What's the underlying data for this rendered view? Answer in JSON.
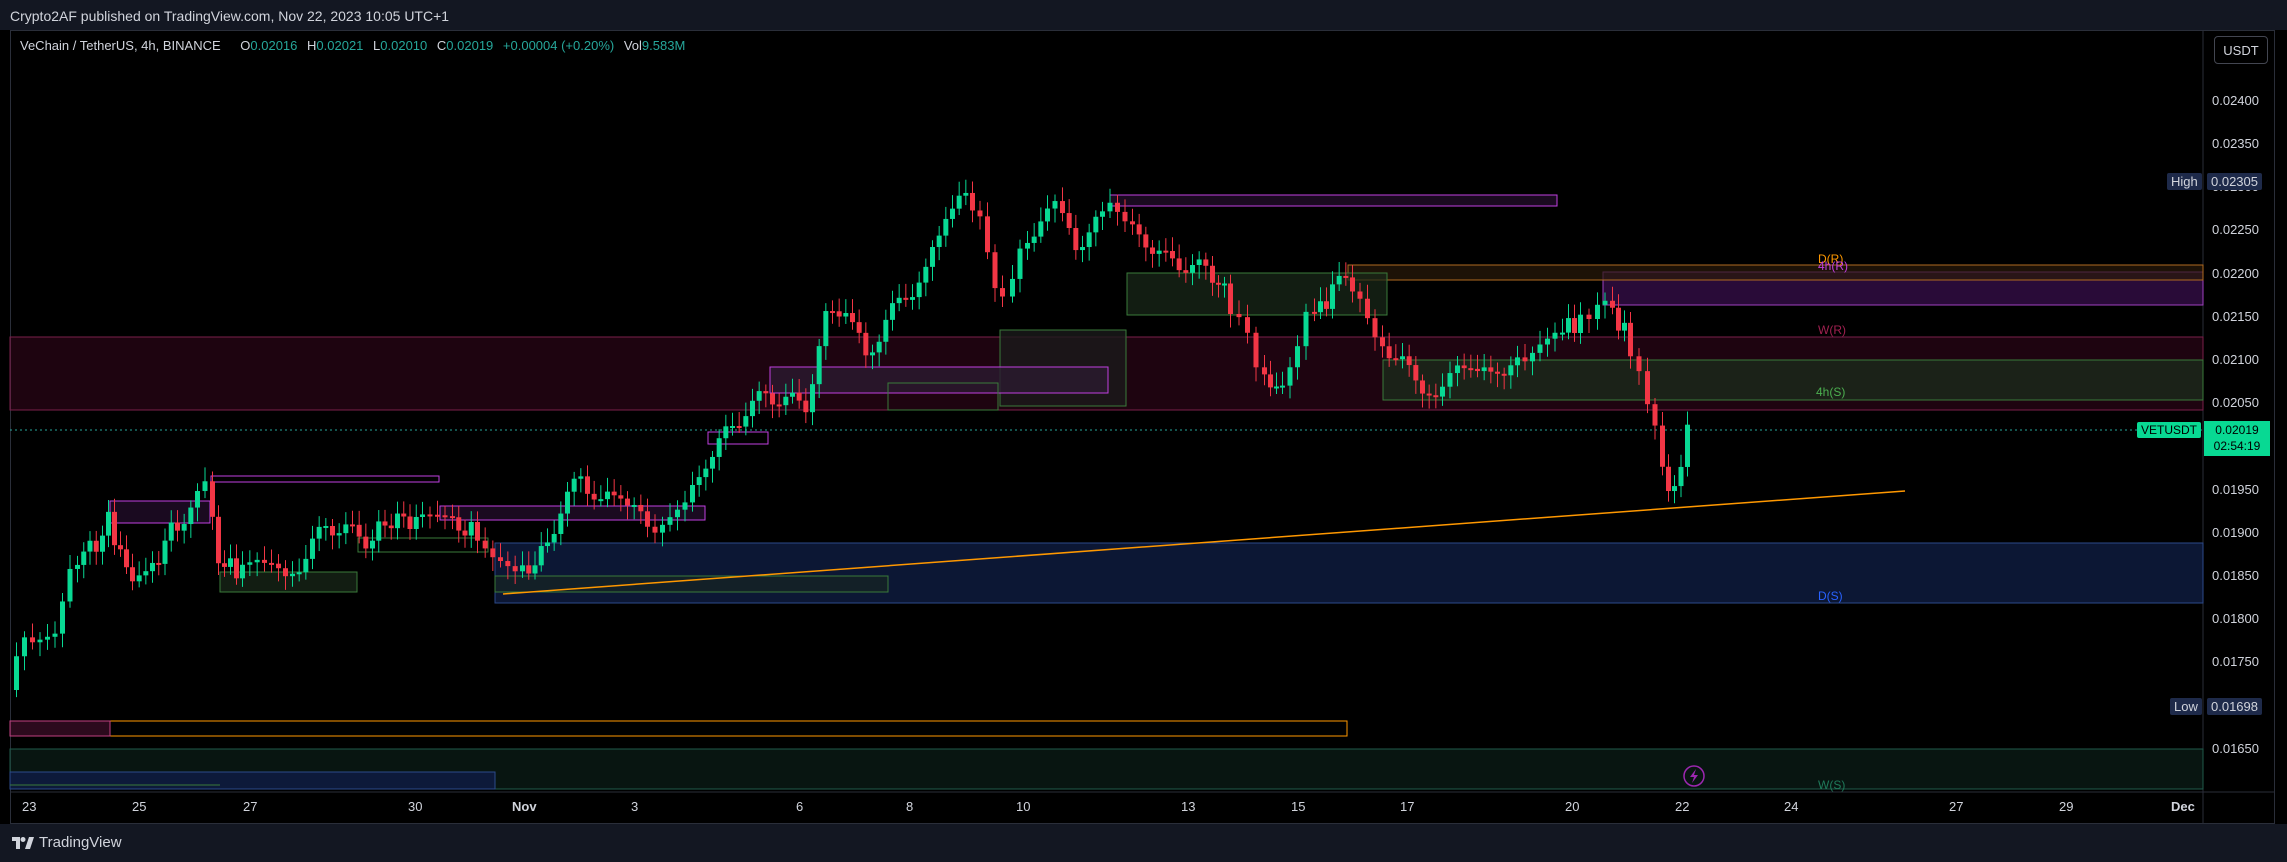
{
  "publisher_line": "Crypto2AF published on TradingView.com, Nov 22, 2023 10:05 UTC+1",
  "symbol_header": {
    "name": "VeChain / TetherUS, 4h, BINANCE",
    "open_label": "O",
    "open": "0.02016",
    "high_label": "H",
    "high": "0.02021",
    "low_label": "L",
    "low": "0.02010",
    "close_label": "C",
    "close": "0.02019",
    "change": "+0.00004 (+0.20%)",
    "vol_label": "Vol",
    "vol": "9.583M"
  },
  "currency_button": "USDT",
  "price_axis": {
    "ticks": [
      "0.02400",
      "0.02350",
      "0.02300",
      "0.02250",
      "0.02200",
      "0.02150",
      "0.02100",
      "0.02050",
      "0.01950",
      "0.01900",
      "0.01850",
      "0.01800",
      "0.01750",
      "0.01650"
    ],
    "high_label": "High",
    "high_value": "0.02305",
    "low_label": "Low",
    "low_value": "0.01698",
    "symbol_tag": "VETUSDT",
    "last_price": "0.02019",
    "countdown": "02:54:19"
  },
  "time_axis": [
    "23",
    "25",
    "27",
    "30",
    "Nov",
    "3",
    "6",
    "8",
    "10",
    "13",
    "15",
    "17",
    "20",
    "22",
    "24",
    "27",
    "29",
    "Dec"
  ],
  "zone_labels": {
    "d_r": "D(R)",
    "h4_r": "4h(R)",
    "w_r": "W(R)",
    "h4_s": "4h(S)",
    "d_s": "D(S)",
    "w_s": "W(S)"
  },
  "footer_brand": "TradingView",
  "colors": {
    "up": "#26a69a",
    "up_bright": "#08d993",
    "down": "#f23645",
    "accent": "#2962ff",
    "trend": "#ff9800"
  }
}
